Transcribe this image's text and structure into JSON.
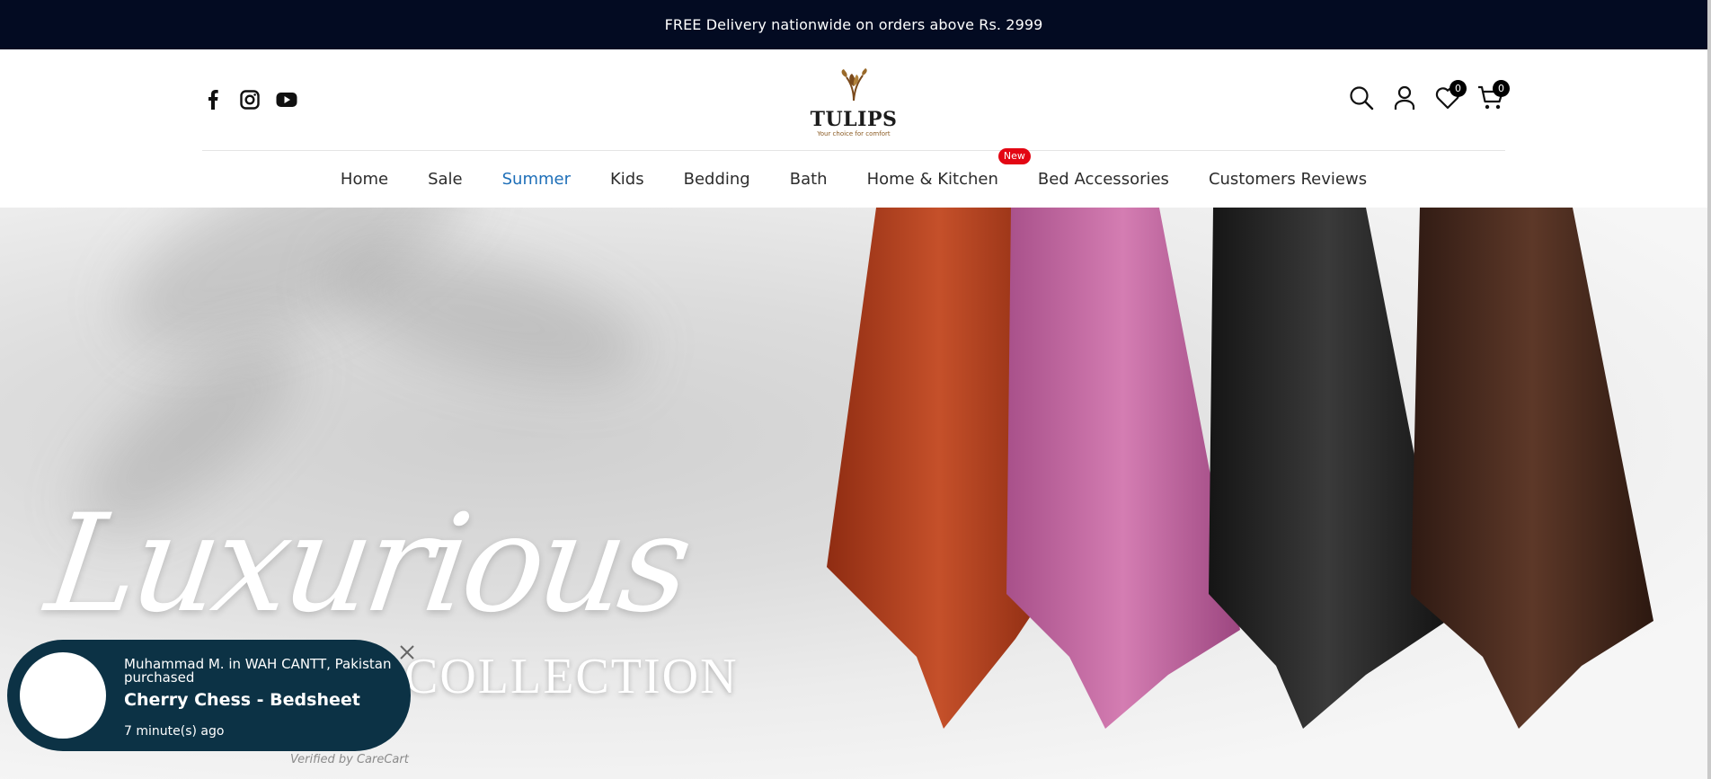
{
  "announcement": {
    "text": "FREE Delivery nationwide on orders above Rs. 2999"
  },
  "header": {
    "social": [
      "facebook-icon",
      "instagram-icon",
      "youtube-icon"
    ],
    "logo": {
      "brand": "TULIPS",
      "tagline": "Your choice for comfort"
    },
    "wishlist_count": "0",
    "cart_count": "0"
  },
  "nav": {
    "items": [
      {
        "label": "Home"
      },
      {
        "label": "Sale"
      },
      {
        "label": "Summer",
        "active": true
      },
      {
        "label": "Kids"
      },
      {
        "label": "Bedding"
      },
      {
        "label": "Bath"
      },
      {
        "label": "Home & Kitchen",
        "badge": "New"
      },
      {
        "label": "Bed Accessories"
      },
      {
        "label": "Customers Reviews"
      }
    ]
  },
  "hero": {
    "script_title": "Luxurious",
    "subtitle": "COLLECTION",
    "towel_colors": [
      "#b5401f",
      "#c4689f",
      "#262626",
      "#4a2c22"
    ]
  },
  "popup": {
    "who": "Muhammad M. in WAH CANTT, Pakistan purchased",
    "product": "Cherry Chess - Bedsheet",
    "ago": "7 minute(s) ago",
    "verified": "Verified by CareCart"
  },
  "colors": {
    "topbar": "#030b22",
    "accent": "#1e6fb8",
    "badge": "#e30613",
    "popup": "#0c3245"
  }
}
